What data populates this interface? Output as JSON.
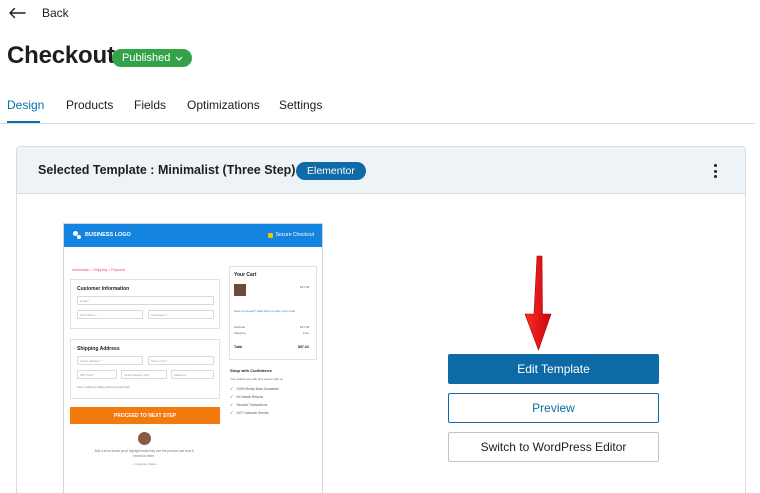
{
  "nav": {
    "back_label": "Back"
  },
  "page": {
    "title": "Checkout",
    "status": "Published"
  },
  "tabs": [
    {
      "label": "Design",
      "active": true
    },
    {
      "label": "Products",
      "active": false
    },
    {
      "label": "Fields",
      "active": false
    },
    {
      "label": "Optimizations",
      "active": false
    },
    {
      "label": "Settings",
      "active": false
    }
  ],
  "panel": {
    "selected_template_text": "Selected Template : Minimalist (Three Step)",
    "builder_badge": "Elementor"
  },
  "preview": {
    "logo_text": "BUSINESS LOGO",
    "secure_text": "Secure Checkout",
    "breadcrumb": "Information > Shipping > Payment",
    "customer_info_title": "Customer Information",
    "email_placeholder": "Email *",
    "first_name_placeholder": "First Name *",
    "last_name_placeholder": "Last Name *",
    "shipping_title": "Shipping Address",
    "street_placeholder": "Street address *",
    "city_placeholder": "Town / City *",
    "zip_placeholder": "ZIP Code *",
    "country_value": "United States (US)",
    "state_value": "Alabama",
    "ship_diff_text": "Use a different billing address (optional)",
    "proceed_button": "PROCEED TO NEXT STEP",
    "quote_text": "Add a short social proof highlight what they see the product and how it moved to them.",
    "quote_author": "— Customer Name",
    "cart_title": "Your Cart",
    "cart_item_price": "$37.50",
    "coupon_link": "Have a coupon? Click here to enter your code",
    "subtotal_label": "Subtotal",
    "subtotal_value": "$37.50",
    "shipping_label": "Shipping",
    "shipping_value": "Free",
    "total_label": "Total",
    "total_value": "$57.34",
    "confidence_title": "Shop with Confidence",
    "confidence_sub": "Your orders are safe and secure with us",
    "benefits": [
      "100% Money Back Guarantee",
      "No Hassle Returns",
      "Secured Transactions",
      "24/7 Customer Service"
    ]
  },
  "actions": {
    "edit_template": "Edit Template",
    "preview": "Preview",
    "switch_editor": "Switch to WordPress Editor"
  },
  "colors": {
    "accent": "#0d6aa6",
    "published_green": "#34a249",
    "arrow_red": "#e01010",
    "proceed_orange": "#f27a0e"
  }
}
